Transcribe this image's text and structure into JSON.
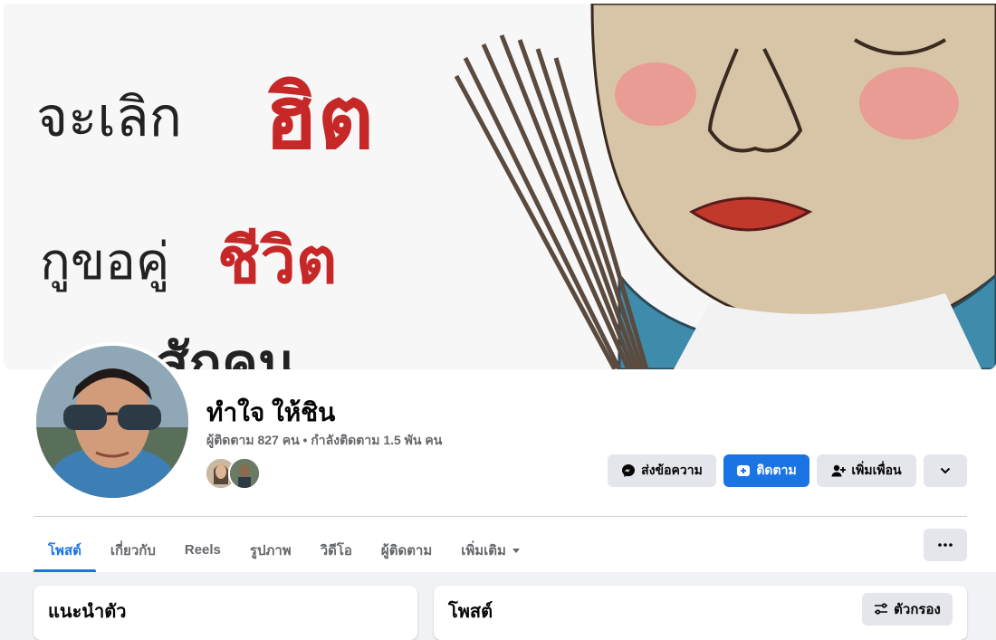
{
  "cover": {
    "line1": "จะเลิก",
    "line1_emphasis": "ฮิต",
    "line2": "กูขอคู่",
    "line2_emphasis": "ชีวิต",
    "line3": "สักคน"
  },
  "profile": {
    "name": "ทำใจ ให้ชิน",
    "stats": "ผู้ติดตาม 827 คน • กำลังติดตาม 1.5 พัน คน"
  },
  "actions": {
    "message_label": "ส่งข้อความ",
    "follow_label": "ติดตาม",
    "add_friend_label": "เพิ่มเพื่อน"
  },
  "tabs": [
    {
      "label": "โพสต์",
      "active": true
    },
    {
      "label": "เกี่ยวกับ",
      "active": false
    },
    {
      "label": "Reels",
      "active": false
    },
    {
      "label": "รูปภาพ",
      "active": false
    },
    {
      "label": "วิดีโอ",
      "active": false
    },
    {
      "label": "ผู้ติดตาม",
      "active": false
    },
    {
      "label": "เพิ่มเติม",
      "active": false
    }
  ],
  "intro": {
    "title": "แนะนำตัว"
  },
  "posts": {
    "title": "โพสต์",
    "filter_label": "ตัวกรอง"
  },
  "colors": {
    "accent": "#1b74e4",
    "button_grey": "#e4e6eb",
    "text_secondary": "#65676b"
  }
}
